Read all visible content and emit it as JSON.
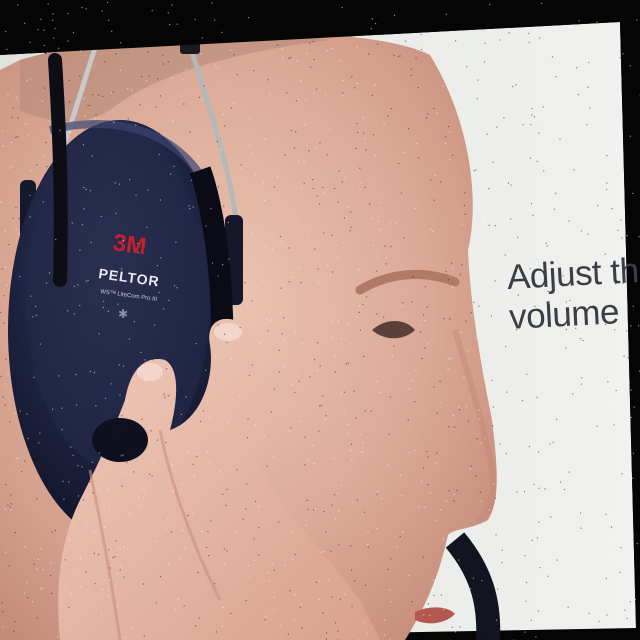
{
  "caption": {
    "line1": "Adjust the",
    "line2": "volume"
  },
  "headset": {
    "brand_logo": "3M",
    "product": "PELTOR",
    "model": "WS™ LiteCom Pro III"
  },
  "colors": {
    "background": "#050505",
    "panel_backdrop": "#e9ebe8",
    "skin": "#e2b6a4",
    "earmuff": "#1b1f3a",
    "brand_red": "#c4202b"
  }
}
